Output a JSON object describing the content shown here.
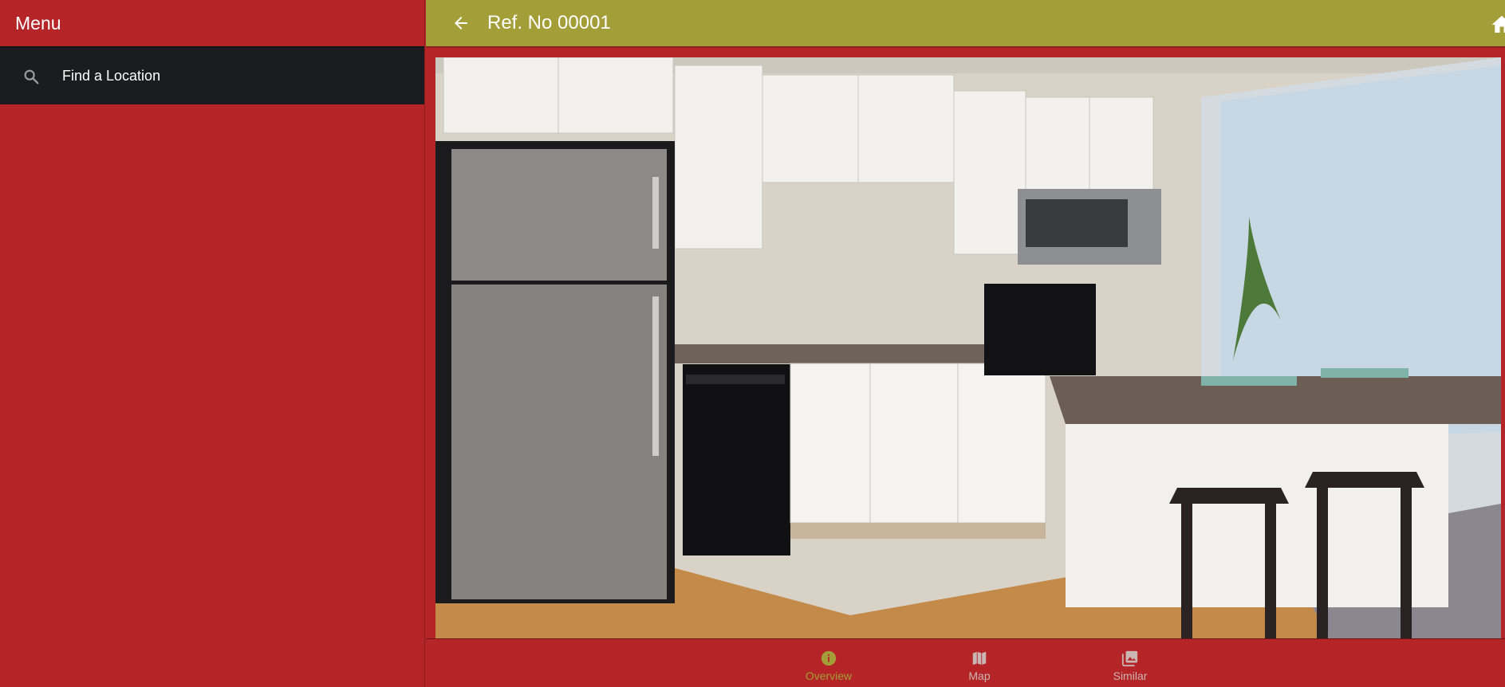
{
  "sidebar": {
    "title": "Menu",
    "items": [
      {
        "label": "Find a Location",
        "icon": "search-icon"
      }
    ]
  },
  "header": {
    "title": "Ref. No 00001",
    "back_icon": "arrow-left-icon",
    "home_icon": "home-icon"
  },
  "photo": {
    "description_icon": "kitchen-photo"
  },
  "bottom_nav": {
    "items": [
      {
        "label": "Overview",
        "icon": "info-icon",
        "active": true
      },
      {
        "label": "Map",
        "icon": "map-icon",
        "active": false
      },
      {
        "label": "Similar",
        "icon": "photo-library-icon",
        "active": false
      }
    ]
  },
  "colors": {
    "primary_red": "#b52426",
    "accent_olive": "#a39e38",
    "dark_item": "#1b1c20"
  }
}
